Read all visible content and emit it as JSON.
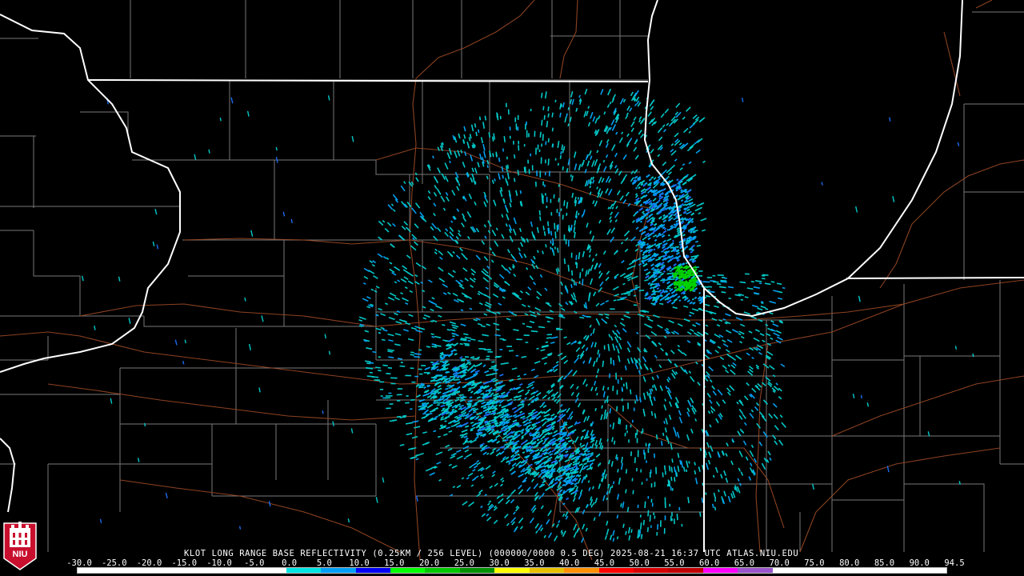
{
  "product": {
    "caption": "KLOT LONG RANGE BASE REFLECTIVITY (0.25KM / 256 LEVEL) (000000/0000 0.5 DEG) 2025-08-21 16:37 UTC  ATLAS.NIU.EDU"
  },
  "logo": {
    "text": "NIU",
    "color": "#c8102e"
  },
  "scale": {
    "labels": [
      "-30.0",
      "-25.0",
      "-20.0",
      "-15.0",
      "-10.0",
      "-5.0",
      "0.0",
      "5.0",
      "10.0",
      "15.0",
      "20.0",
      "25.0",
      "30.0",
      "35.0",
      "40.0",
      "45.0",
      "50.0",
      "55.0",
      "60.0",
      "65.0",
      "70.0",
      "75.0",
      "80.0",
      "85.0",
      "90.0",
      "94.5"
    ],
    "colors": [
      "#ffffff",
      "#ffffff",
      "#ffffff",
      "#ffffff",
      "#ffffff",
      "#ffffff",
      "#00e4e4",
      "#01a0f6",
      "#0000f6",
      "#00ff00",
      "#00c800",
      "#009000",
      "#ffff00",
      "#e7c000",
      "#ff9000",
      "#ff0000",
      "#d60000",
      "#c00000",
      "#ff00ff",
      "#9955c9",
      "#ffffff",
      "#ffffff",
      "#ffffff",
      "#ffffff",
      "#ffffff"
    ]
  },
  "map": {
    "state_border_color": "#ffffff",
    "county_line_color": "#9a9a9a",
    "highway_color": "#a0522d",
    "echo_colors": [
      "#00c8c8",
      "#00a0f0",
      "#1c6cf0",
      "#00d000"
    ]
  }
}
